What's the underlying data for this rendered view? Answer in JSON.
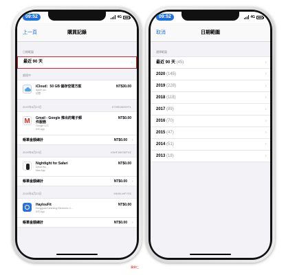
{
  "left": {
    "time": "09:52",
    "network": "4G",
    "nav": {
      "back": "上一頁",
      "title": "購買記錄"
    },
    "range_section": {
      "header": "日期範圍",
      "value": "最近 90 天"
    },
    "pending_header": "處理中",
    "icloud": {
      "name": "iCloud：50 GB 儲存空間方案",
      "sub1": "Apple Inc.",
      "sub2": "訂閱",
      "price": "NT$30.00"
    },
    "date1": {
      "date": "2020年8月23日",
      "id": "K7HR4NH5YFL"
    },
    "gmail": {
      "name": "Gmail - Google 推出的電子郵",
      "name2": "件服務",
      "sub1": "Google LLC",
      "sub2": "iOS App",
      "price": "NT$0.00"
    },
    "total1": {
      "label": "帳單金額總計",
      "value": "NT$0.00"
    },
    "date2": {
      "date": "2020年8月23日",
      "id": "K5HFJ6KSEFXZ"
    },
    "nightlight": {
      "name": "Nightlight for Safari",
      "sub1": "David Wu",
      "sub2": "Mac App",
      "price": "NT$0.00"
    },
    "total2": {
      "label": "帳單金額總計",
      "value": "NT$0.00"
    },
    "date3": {
      "date": "2020年8月23日",
      "id": "K5HB-WFY3S"
    },
    "hayou": {
      "name": "HaylouFit",
      "sub1": "Dongguan Liesheng Electronic C...",
      "sub2": "iOS App",
      "price": "NT$0.00"
    },
    "total3": {
      "label": "帳單金額總計",
      "value": "NT$0.00"
    }
  },
  "right": {
    "time": "09:52",
    "network": "4G",
    "nav": {
      "back": "取消",
      "title": "日期範圍"
    },
    "header": "選擇範圍",
    "ranges": [
      {
        "label": "最近 90 天",
        "count": "(45)"
      },
      {
        "label": "2020",
        "count": "(145)"
      },
      {
        "label": "2019",
        "count": "(228)"
      },
      {
        "label": "2018",
        "count": "(118)"
      },
      {
        "label": "2017",
        "count": "(89)"
      },
      {
        "label": "2016",
        "count": "(70)"
      },
      {
        "label": "2015",
        "count": "(47)"
      },
      {
        "label": "2014",
        "count": "(51)"
      },
      {
        "label": "2013",
        "count": "(18)"
      }
    ]
  },
  "watermark": "蘋果仁"
}
